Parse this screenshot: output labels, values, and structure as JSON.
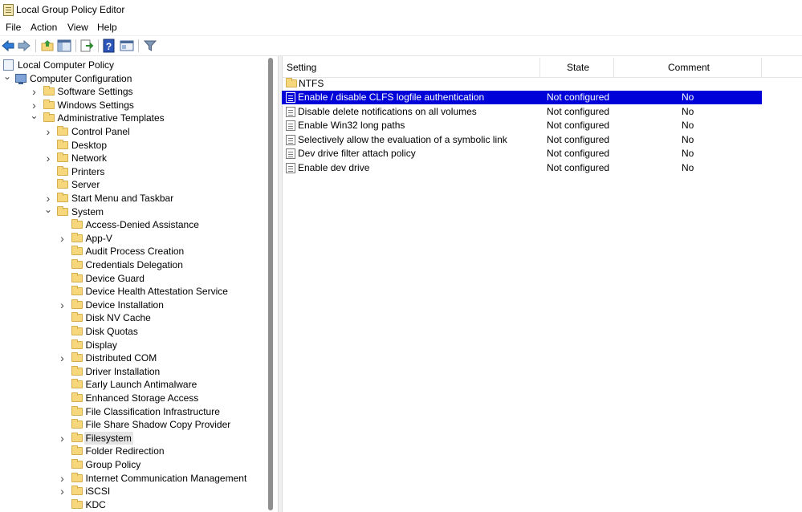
{
  "window": {
    "title": "Local Group Policy Editor"
  },
  "menu": [
    "File",
    "Action",
    "View",
    "Help"
  ],
  "toolbar": {
    "buttons": [
      "back-arrow-icon",
      "forward-arrow-icon",
      "up-folder-icon",
      "show-hide-tree-icon",
      "export-list-icon",
      "help-icon",
      "properties-icon",
      "filter-icon"
    ]
  },
  "tree": [
    {
      "label": "Local Computer Policy",
      "indent": 0,
      "expander": "",
      "icon": "policy"
    },
    {
      "label": "Computer Configuration",
      "indent": 0,
      "expander": "down",
      "icon": "computer"
    },
    {
      "label": "Software Settings",
      "indent": 1,
      "expander": "right",
      "icon": "folder"
    },
    {
      "label": "Windows Settings",
      "indent": 1,
      "expander": "right",
      "icon": "folder"
    },
    {
      "label": "Administrative Templates",
      "indent": 1,
      "expander": "down",
      "icon": "folder"
    },
    {
      "label": "Control Panel",
      "indent": 2,
      "expander": "right",
      "icon": "folder"
    },
    {
      "label": "Desktop",
      "indent": 2,
      "expander": "",
      "icon": "folder"
    },
    {
      "label": "Network",
      "indent": 2,
      "expander": "right",
      "icon": "folder"
    },
    {
      "label": "Printers",
      "indent": 2,
      "expander": "",
      "icon": "folder"
    },
    {
      "label": "Server",
      "indent": 2,
      "expander": "",
      "icon": "folder"
    },
    {
      "label": "Start Menu and Taskbar",
      "indent": 2,
      "expander": "right",
      "icon": "folder"
    },
    {
      "label": "System",
      "indent": 2,
      "expander": "down",
      "icon": "folder"
    },
    {
      "label": "Access-Denied Assistance",
      "indent": 3,
      "expander": "",
      "icon": "folder"
    },
    {
      "label": "App-V",
      "indent": 3,
      "expander": "right",
      "icon": "folder"
    },
    {
      "label": "Audit Process Creation",
      "indent": 3,
      "expander": "",
      "icon": "folder"
    },
    {
      "label": "Credentials Delegation",
      "indent": 3,
      "expander": "",
      "icon": "folder"
    },
    {
      "label": "Device Guard",
      "indent": 3,
      "expander": "",
      "icon": "folder"
    },
    {
      "label": "Device Health Attestation Service",
      "indent": 3,
      "expander": "",
      "icon": "folder"
    },
    {
      "label": "Device Installation",
      "indent": 3,
      "expander": "right",
      "icon": "folder"
    },
    {
      "label": "Disk NV Cache",
      "indent": 3,
      "expander": "",
      "icon": "folder"
    },
    {
      "label": "Disk Quotas",
      "indent": 3,
      "expander": "",
      "icon": "folder"
    },
    {
      "label": "Display",
      "indent": 3,
      "expander": "",
      "icon": "folder"
    },
    {
      "label": "Distributed COM",
      "indent": 3,
      "expander": "right",
      "icon": "folder"
    },
    {
      "label": "Driver Installation",
      "indent": 3,
      "expander": "",
      "icon": "folder"
    },
    {
      "label": "Early Launch Antimalware",
      "indent": 3,
      "expander": "",
      "icon": "folder"
    },
    {
      "label": "Enhanced Storage Access",
      "indent": 3,
      "expander": "",
      "icon": "folder"
    },
    {
      "label": "File Classification Infrastructure",
      "indent": 3,
      "expander": "",
      "icon": "folder"
    },
    {
      "label": "File Share Shadow Copy Provider",
      "indent": 3,
      "expander": "",
      "icon": "folder"
    },
    {
      "label": "Filesystem",
      "indent": 3,
      "expander": "right",
      "icon": "folder",
      "selected": true
    },
    {
      "label": "Folder Redirection",
      "indent": 3,
      "expander": "",
      "icon": "folder"
    },
    {
      "label": "Group Policy",
      "indent": 3,
      "expander": "",
      "icon": "folder"
    },
    {
      "label": "Internet Communication Management",
      "indent": 3,
      "expander": "right",
      "icon": "folder"
    },
    {
      "label": "iSCSI",
      "indent": 3,
      "expander": "right",
      "icon": "folder"
    },
    {
      "label": "KDC",
      "indent": 3,
      "expander": "",
      "icon": "folder"
    }
  ],
  "list": {
    "columns": [
      "Setting",
      "State",
      "Comment"
    ],
    "folder_row": {
      "label": "NTFS"
    },
    "rows": [
      {
        "setting": "Enable / disable CLFS logfile authentication",
        "state": "Not configured",
        "comment": "No",
        "selected": true
      },
      {
        "setting": "Disable delete notifications on all volumes",
        "state": "Not configured",
        "comment": "No"
      },
      {
        "setting": "Enable Win32 long paths",
        "state": "Not configured",
        "comment": "No"
      },
      {
        "setting": "Selectively allow the evaluation of a symbolic link",
        "state": "Not configured",
        "comment": "No"
      },
      {
        "setting": "Dev drive filter attach policy",
        "state": "Not configured",
        "comment": "No"
      },
      {
        "setting": "Enable dev drive",
        "state": "Not configured",
        "comment": "No"
      }
    ]
  },
  "colors": {
    "selection": "#0000d8",
    "folder": "#f6d77c"
  }
}
